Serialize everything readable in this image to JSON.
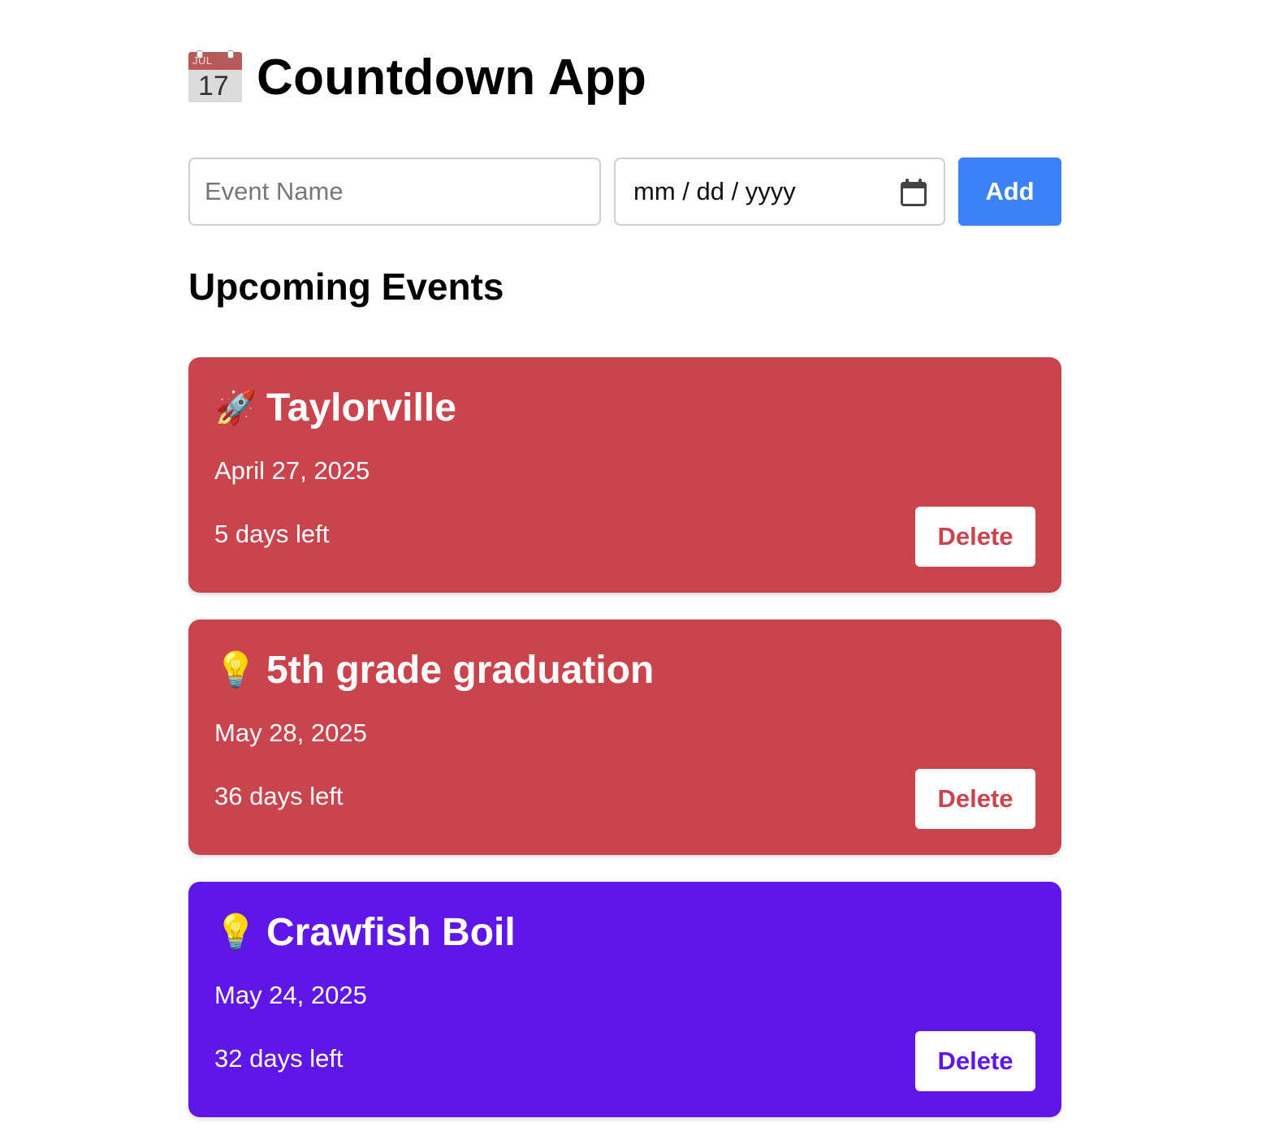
{
  "header": {
    "title": "Countdown App",
    "icon": "calendar-icon",
    "icon_month": "JUL",
    "icon_day": "17"
  },
  "form": {
    "name_placeholder": "Event Name",
    "date_placeholder": "mm / dd / yyyy",
    "add_label": "Add",
    "add_color": "#3b82f6"
  },
  "section_title": "Upcoming Events",
  "events": [
    {
      "emoji": "🚀",
      "emoji_name": "rocket-icon",
      "name": "Taylorville",
      "date": "April 27, 2025",
      "days_left": "5 days left",
      "delete_label": "Delete",
      "color": "#c9444c"
    },
    {
      "emoji": "💡",
      "emoji_name": "lightbulb-icon",
      "name": "5th grade graduation",
      "date": "May 28, 2025",
      "days_left": "36 days left",
      "delete_label": "Delete",
      "color": "#c9444c"
    },
    {
      "emoji": "💡",
      "emoji_name": "lightbulb-icon",
      "name": "Crawfish Boil",
      "date": "May 24, 2025",
      "days_left": "32 days left",
      "delete_label": "Delete",
      "color": "#5e17e8"
    }
  ]
}
